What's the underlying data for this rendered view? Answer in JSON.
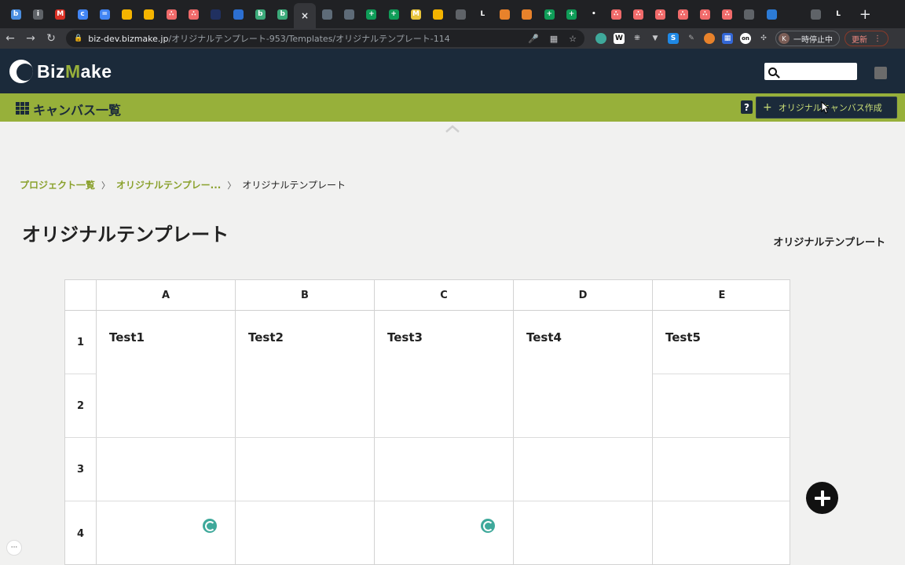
{
  "browser": {
    "tabs": [
      {
        "icon": "doc-icon",
        "color": "#4a8ee0",
        "glyph": "b"
      },
      {
        "icon": "info-icon",
        "color": "#5f6368",
        "glyph": "i"
      },
      {
        "icon": "gmail-icon",
        "color": "#d93025",
        "glyph": "M"
      },
      {
        "icon": "calendar-icon",
        "color": "#4285f4",
        "glyph": "c"
      },
      {
        "icon": "docs-icon",
        "color": "#4285f4",
        "glyph": "="
      },
      {
        "icon": "folder-icon",
        "color": "#f5b400",
        "glyph": ""
      },
      {
        "icon": "folder-icon",
        "color": "#f5b400",
        "glyph": ""
      },
      {
        "icon": "asana-icon",
        "color": "#f06a6a",
        "glyph": "∴"
      },
      {
        "icon": "asana-icon",
        "color": "#f06a6a",
        "glyph": "∴"
      },
      {
        "icon": "dot-icon",
        "color": "#203060",
        "glyph": ""
      },
      {
        "icon": "app-icon",
        "color": "#2c6fd1",
        "glyph": ""
      },
      {
        "icon": "b-icon",
        "color": "#3caa7a",
        "glyph": "b"
      },
      {
        "icon": "b-icon",
        "color": "#3caa7a",
        "glyph": "b"
      },
      {
        "icon": "close-icon",
        "color": "#35363a",
        "glyph": "×",
        "active": true
      },
      {
        "icon": "layers-icon",
        "color": "#5e6b78",
        "glyph": ""
      },
      {
        "icon": "layers-icon",
        "color": "#5e6b78",
        "glyph": ""
      },
      {
        "icon": "sheets-icon",
        "color": "#0f9d58",
        "glyph": "+"
      },
      {
        "icon": "sheets-icon",
        "color": "#0f9d58",
        "glyph": "+"
      },
      {
        "icon": "m-icon",
        "color": "#e8c43a",
        "glyph": "M"
      },
      {
        "icon": "slides-icon",
        "color": "#f4b400",
        "glyph": ""
      },
      {
        "icon": "globe-icon",
        "color": "#5f6368",
        "glyph": ""
      },
      {
        "icon": "l-icon",
        "color": "#202124",
        "glyph": "L"
      },
      {
        "icon": "cube-icon",
        "color": "#e8822b",
        "glyph": ""
      },
      {
        "icon": "cube-icon",
        "color": "#e8822b",
        "glyph": ""
      },
      {
        "icon": "sheets-icon",
        "color": "#0f9d58",
        "glyph": "+"
      },
      {
        "icon": "sheets-icon",
        "color": "#0f9d58",
        "glyph": "+"
      },
      {
        "icon": "mic-icon",
        "color": "#202124",
        "glyph": "•"
      },
      {
        "icon": "asana-icon",
        "color": "#f06a6a",
        "glyph": "∴"
      },
      {
        "icon": "asana-icon",
        "color": "#f06a6a",
        "glyph": "∴"
      },
      {
        "icon": "asana-icon",
        "color": "#f06a6a",
        "glyph": "∴"
      },
      {
        "icon": "asana-icon",
        "color": "#f06a6a",
        "glyph": "∴"
      },
      {
        "icon": "asana-icon",
        "color": "#f06a6a",
        "glyph": "∴"
      },
      {
        "icon": "asana-icon",
        "color": "#f06a6a",
        "glyph": "∴"
      },
      {
        "icon": "bag-icon",
        "color": "#5f6368",
        "glyph": ""
      },
      {
        "icon": "trello-icon",
        "color": "#2c7bd6",
        "glyph": ""
      },
      {
        "icon": "blank-icon",
        "color": "#202124",
        "glyph": ""
      },
      {
        "icon": "globe-icon",
        "color": "#5f6368",
        "glyph": ""
      },
      {
        "icon": "l-icon",
        "color": "#202124",
        "glyph": "L"
      }
    ],
    "new_tab": "+",
    "url_host": "biz-dev.bizmake.jp",
    "url_path": "/オリジナルテンプレート-953/Templates/オリジナルテンプレート-114",
    "profile_initial": "K",
    "profile_status": "一時停止中",
    "update_label": "更新"
  },
  "app": {
    "logo_text_a": "Biz",
    "logo_text_b": "M",
    "logo_text_c": "ake",
    "search_placeholder": ""
  },
  "subheader": {
    "title": "キャンバス一覧",
    "help": "?",
    "create_button": "オリジナルキャンバス作成"
  },
  "breadcrumb": {
    "items": [
      "プロジェクト一覧",
      "オリジナルテンプレー..."
    ],
    "separator": "〉",
    "current": "オリジナルテンプレート"
  },
  "page": {
    "title": "オリジナルテンプレート",
    "subtitle": "オリジナルテンプレート"
  },
  "canvas": {
    "columns": [
      "A",
      "B",
      "C",
      "D",
      "E"
    ],
    "rows": [
      "1",
      "2",
      "3",
      "4"
    ],
    "blocks": [
      "Test1",
      "Test2",
      "Test3",
      "Test4",
      "Test5"
    ]
  },
  "colors": {
    "header": "#1b2a3a",
    "accent": "#97b03a",
    "link": "#8aa12d"
  }
}
